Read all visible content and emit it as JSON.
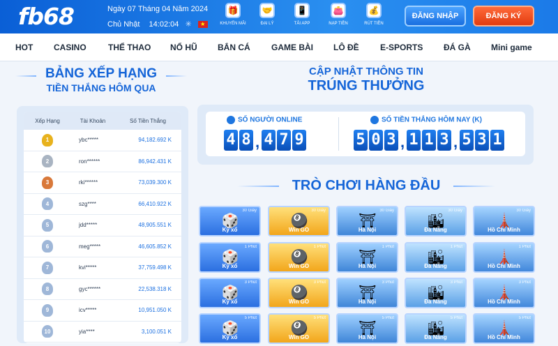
{
  "header": {
    "logo": "fb68",
    "date_line": "Ngày 07 Tháng 04 Năm 2024",
    "day_label": "Chủ Nhật",
    "time": "14:02:04",
    "quick_links": [
      {
        "label": "KHUYẾN MÃI",
        "icon": "gift-icon"
      },
      {
        "label": "ĐẠI LÝ",
        "icon": "handshake-icon"
      },
      {
        "label": "TẢI APP",
        "icon": "phone-icon"
      },
      {
        "label": "NẠP TIỀN",
        "icon": "wallet-icon"
      },
      {
        "label": "RÚT TIỀN",
        "icon": "cash-icon"
      }
    ],
    "login_label": "ĐĂNG NHẬP",
    "register_label": "ĐĂNG KÝ"
  },
  "nav": [
    "HOT",
    "CASINO",
    "THỂ THAO",
    "NỔ HŨ",
    "BẮN CÁ",
    "GAME BÀI",
    "LÔ ĐỀ",
    "E-SPORTS",
    "ĐÁ GÀ",
    "Mini game"
  ],
  "ranking": {
    "title": "BẢNG XẾP HẠNG",
    "subtitle": "TIỀN THẮNG HÔM QUA",
    "headers": [
      "Xếp Hạng",
      "Tài Khoản",
      "Số Tiền Thắng"
    ],
    "rows": [
      {
        "rank": "1",
        "account": "ybc*****",
        "amount": "94,182.692 K"
      },
      {
        "rank": "2",
        "account": "ron******",
        "amount": "86,942.431 K"
      },
      {
        "rank": "3",
        "account": "rki******",
        "amount": "73,039.300 K"
      },
      {
        "rank": "4",
        "account": "szg****",
        "amount": "66,410.922 K"
      },
      {
        "rank": "5",
        "account": "jdd*****",
        "amount": "48,905.551 K"
      },
      {
        "rank": "6",
        "account": "meg*****",
        "amount": "46,605.852 K"
      },
      {
        "rank": "7",
        "account": "kvi*****",
        "amount": "37,759.498 K"
      },
      {
        "rank": "8",
        "account": "gyc******",
        "amount": "22,538.318 K"
      },
      {
        "rank": "9",
        "account": "icv*****",
        "amount": "10,951.050 K"
      },
      {
        "rank": "10",
        "account": "yia****",
        "amount": "3,100.051 K"
      }
    ]
  },
  "winners": {
    "title1": "CẬP NHẬT THÔNG TIN",
    "title2": "TRÚNG THƯỞNG",
    "online_label": "SỐ NGƯỜI ONLINE",
    "online_digits": [
      "4",
      "8",
      "4",
      "7",
      "9"
    ],
    "money_label": "SỐ TIỀN THẮNG HÔM NAY (K)",
    "money_digits": [
      "5",
      "0",
      "3",
      "1",
      "1",
      "3",
      "5",
      "3",
      "1"
    ]
  },
  "top_games": {
    "title": "TRÒ CHƠI HÀNG ĐẦU",
    "rows": [
      [
        {
          "name": "Kỳ xổ",
          "time": "30 Giây",
          "theme": "kx",
          "icon": "dice-icon"
        },
        {
          "name": "Win GO",
          "time": "30 Giây",
          "theme": "wg",
          "icon": "lottery-ball-icon"
        },
        {
          "name": "Hà Nội",
          "time": "30 Giây",
          "theme": "hn",
          "icon": "temple-icon"
        },
        {
          "name": "Đà Nẵng",
          "time": "30 Giây",
          "theme": "dn",
          "icon": "city-icon"
        },
        {
          "name": "Hồ Chí Minh",
          "time": "30 Giây",
          "theme": "hcm",
          "icon": "tower-icon"
        }
      ],
      [
        {
          "name": "Kỳ xổ",
          "time": "1 Phút",
          "theme": "kx",
          "icon": "dice-icon"
        },
        {
          "name": "Win GO",
          "time": "1 Phút",
          "theme": "wg",
          "icon": "lottery-ball-icon"
        },
        {
          "name": "Hà Nội",
          "time": "1 Phút",
          "theme": "hn",
          "icon": "temple-icon"
        },
        {
          "name": "Đà Nẵng",
          "time": "1 Phút",
          "theme": "dn",
          "icon": "city-icon"
        },
        {
          "name": "Hồ Chí Minh",
          "time": "1 Phút",
          "theme": "hcm",
          "icon": "tower-icon"
        }
      ],
      [
        {
          "name": "Kỳ xổ",
          "time": "3 Phút",
          "theme": "kx",
          "icon": "dice-icon"
        },
        {
          "name": "Win GO",
          "time": "3 Phút",
          "theme": "wg",
          "icon": "lottery-ball-icon"
        },
        {
          "name": "Hà Nội",
          "time": "3 Phút",
          "theme": "hn",
          "icon": "temple-icon"
        },
        {
          "name": "Đà Nẵng",
          "time": "3 Phút",
          "theme": "dn",
          "icon": "city-icon"
        },
        {
          "name": "Hồ Chí Minh",
          "time": "3 Phút",
          "theme": "hcm",
          "icon": "tower-icon"
        }
      ],
      [
        {
          "name": "Kỳ xổ",
          "time": "5 Phút",
          "theme": "kx",
          "icon": "dice-icon"
        },
        {
          "name": "Win GO",
          "time": "5 Phút",
          "theme": "wg",
          "icon": "lottery-ball-icon"
        },
        {
          "name": "Hà Nội",
          "time": "5 Phút",
          "theme": "hn",
          "icon": "temple-icon"
        },
        {
          "name": "Đà Nẵng",
          "time": "5 Phút",
          "theme": "dn",
          "icon": "city-icon"
        },
        {
          "name": "Hồ Chí Minh",
          "time": "5 Phút",
          "theme": "hcm",
          "icon": "tower-icon"
        }
      ]
    ]
  }
}
